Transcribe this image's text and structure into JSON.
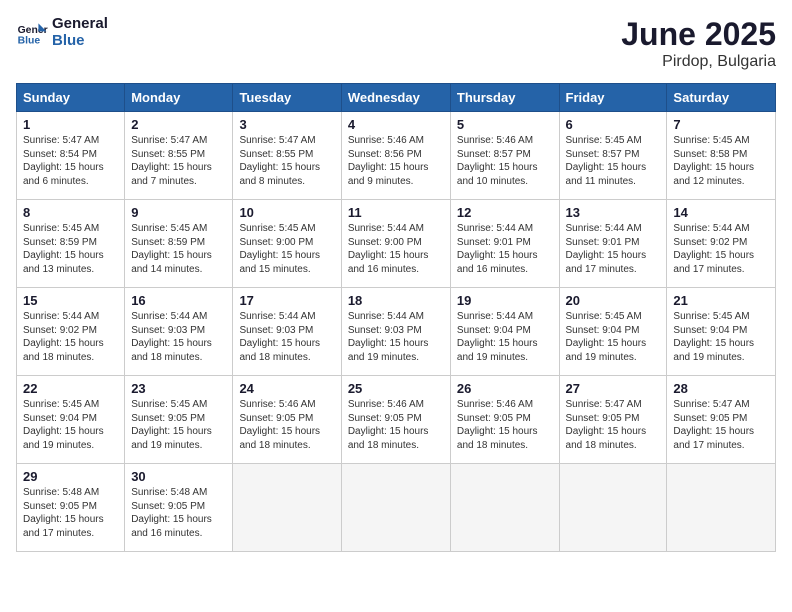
{
  "logo": {
    "line1": "General",
    "line2": "Blue"
  },
  "title": "June 2025",
  "subtitle": "Pirdop, Bulgaria",
  "weekdays": [
    "Sunday",
    "Monday",
    "Tuesday",
    "Wednesday",
    "Thursday",
    "Friday",
    "Saturday"
  ],
  "weeks": [
    [
      {
        "day": "1",
        "sunrise": "5:47 AM",
        "sunset": "8:54 PM",
        "daylight": "15 hours and 6 minutes."
      },
      {
        "day": "2",
        "sunrise": "5:47 AM",
        "sunset": "8:55 PM",
        "daylight": "15 hours and 7 minutes."
      },
      {
        "day": "3",
        "sunrise": "5:47 AM",
        "sunset": "8:55 PM",
        "daylight": "15 hours and 8 minutes."
      },
      {
        "day": "4",
        "sunrise": "5:46 AM",
        "sunset": "8:56 PM",
        "daylight": "15 hours and 9 minutes."
      },
      {
        "day": "5",
        "sunrise": "5:46 AM",
        "sunset": "8:57 PM",
        "daylight": "15 hours and 10 minutes."
      },
      {
        "day": "6",
        "sunrise": "5:45 AM",
        "sunset": "8:57 PM",
        "daylight": "15 hours and 11 minutes."
      },
      {
        "day": "7",
        "sunrise": "5:45 AM",
        "sunset": "8:58 PM",
        "daylight": "15 hours and 12 minutes."
      }
    ],
    [
      {
        "day": "8",
        "sunrise": "5:45 AM",
        "sunset": "8:59 PM",
        "daylight": "15 hours and 13 minutes."
      },
      {
        "day": "9",
        "sunrise": "5:45 AM",
        "sunset": "8:59 PM",
        "daylight": "15 hours and 14 minutes."
      },
      {
        "day": "10",
        "sunrise": "5:45 AM",
        "sunset": "9:00 PM",
        "daylight": "15 hours and 15 minutes."
      },
      {
        "day": "11",
        "sunrise": "5:44 AM",
        "sunset": "9:00 PM",
        "daylight": "15 hours and 16 minutes."
      },
      {
        "day": "12",
        "sunrise": "5:44 AM",
        "sunset": "9:01 PM",
        "daylight": "15 hours and 16 minutes."
      },
      {
        "day": "13",
        "sunrise": "5:44 AM",
        "sunset": "9:01 PM",
        "daylight": "15 hours and 17 minutes."
      },
      {
        "day": "14",
        "sunrise": "5:44 AM",
        "sunset": "9:02 PM",
        "daylight": "15 hours and 17 minutes."
      }
    ],
    [
      {
        "day": "15",
        "sunrise": "5:44 AM",
        "sunset": "9:02 PM",
        "daylight": "15 hours and 18 minutes."
      },
      {
        "day": "16",
        "sunrise": "5:44 AM",
        "sunset": "9:03 PM",
        "daylight": "15 hours and 18 minutes."
      },
      {
        "day": "17",
        "sunrise": "5:44 AM",
        "sunset": "9:03 PM",
        "daylight": "15 hours and 18 minutes."
      },
      {
        "day": "18",
        "sunrise": "5:44 AM",
        "sunset": "9:03 PM",
        "daylight": "15 hours and 19 minutes."
      },
      {
        "day": "19",
        "sunrise": "5:44 AM",
        "sunset": "9:04 PM",
        "daylight": "15 hours and 19 minutes."
      },
      {
        "day": "20",
        "sunrise": "5:45 AM",
        "sunset": "9:04 PM",
        "daylight": "15 hours and 19 minutes."
      },
      {
        "day": "21",
        "sunrise": "5:45 AM",
        "sunset": "9:04 PM",
        "daylight": "15 hours and 19 minutes."
      }
    ],
    [
      {
        "day": "22",
        "sunrise": "5:45 AM",
        "sunset": "9:04 PM",
        "daylight": "15 hours and 19 minutes."
      },
      {
        "day": "23",
        "sunrise": "5:45 AM",
        "sunset": "9:05 PM",
        "daylight": "15 hours and 19 minutes."
      },
      {
        "day": "24",
        "sunrise": "5:46 AM",
        "sunset": "9:05 PM",
        "daylight": "15 hours and 18 minutes."
      },
      {
        "day": "25",
        "sunrise": "5:46 AM",
        "sunset": "9:05 PM",
        "daylight": "15 hours and 18 minutes."
      },
      {
        "day": "26",
        "sunrise": "5:46 AM",
        "sunset": "9:05 PM",
        "daylight": "15 hours and 18 minutes."
      },
      {
        "day": "27",
        "sunrise": "5:47 AM",
        "sunset": "9:05 PM",
        "daylight": "15 hours and 18 minutes."
      },
      {
        "day": "28",
        "sunrise": "5:47 AM",
        "sunset": "9:05 PM",
        "daylight": "15 hours and 17 minutes."
      }
    ],
    [
      {
        "day": "29",
        "sunrise": "5:48 AM",
        "sunset": "9:05 PM",
        "daylight": "15 hours and 17 minutes."
      },
      {
        "day": "30",
        "sunrise": "5:48 AM",
        "sunset": "9:05 PM",
        "daylight": "15 hours and 16 minutes."
      },
      null,
      null,
      null,
      null,
      null
    ]
  ],
  "labels": {
    "sunrise": "Sunrise:",
    "sunset": "Sunset:",
    "daylight": "Daylight:"
  }
}
